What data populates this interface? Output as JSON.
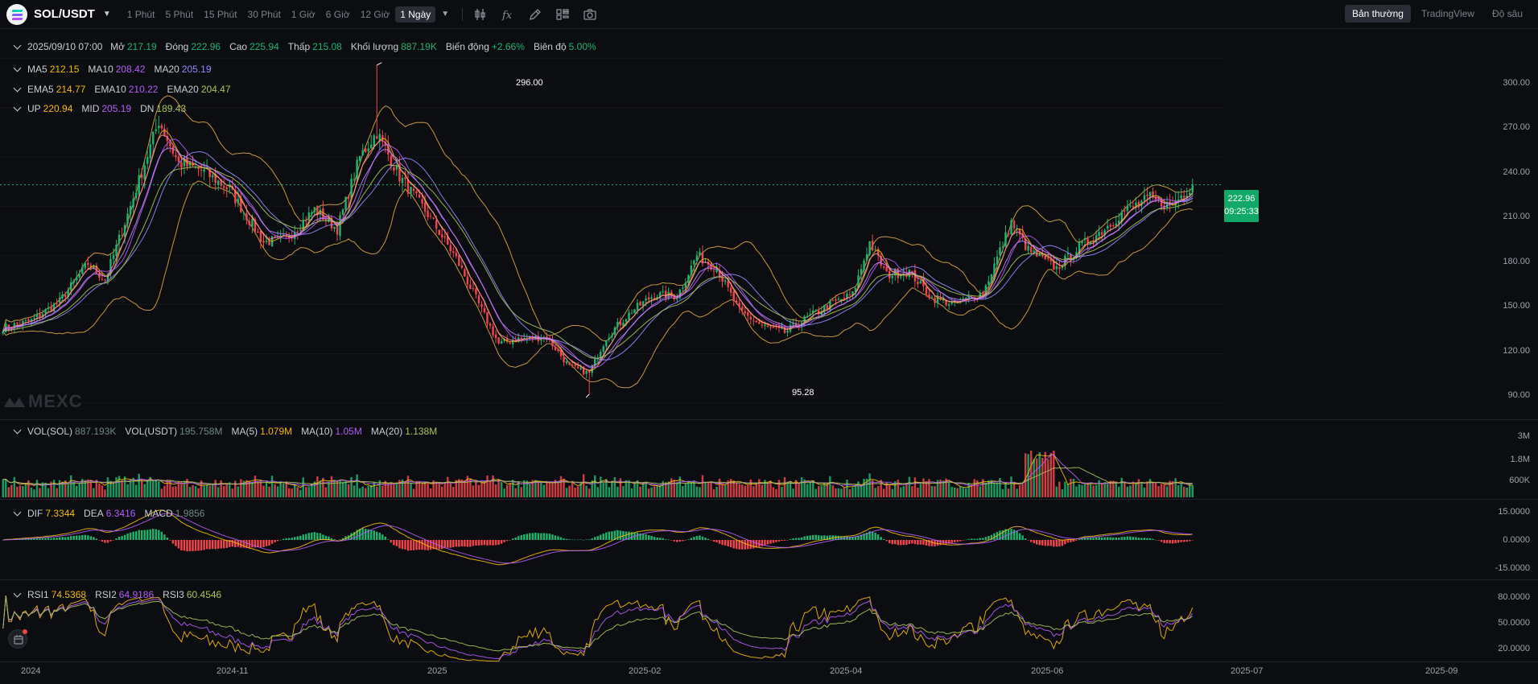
{
  "toolbar": {
    "symbol": "SOL/USDT",
    "intervals": [
      "1 Phút",
      "5 Phút",
      "15 Phút",
      "30 Phút",
      "1 Giờ",
      "6 Giờ",
      "12 Giờ",
      "1 Ngày"
    ],
    "active_interval": "1 Ngày",
    "tools": [
      "indicator-icon",
      "function-icon",
      "draw-icon",
      "layout-icon",
      "camera-icon"
    ],
    "views": [
      "Bản thường",
      "TradingView",
      "Độ sâu"
    ],
    "active_view": "Bản thường"
  },
  "ohlc": {
    "date": "2025/09/10 07:00",
    "open_label": "Mở",
    "open": "217.19",
    "close_label": "Đóng",
    "close": "222.96",
    "high_label": "Cao",
    "high": "225.94",
    "low_label": "Thấp",
    "low": "215.08",
    "volume_label": "Khối lượng",
    "volume": "887.19K",
    "change_label": "Biến động",
    "change": "+2.66%",
    "amplitude_label": "Biên độ",
    "amplitude": "5.00%"
  },
  "ma": {
    "ma5_label": "MA5",
    "ma5": "212.15",
    "ma10_label": "MA10",
    "ma10": "208.42",
    "ma20_label": "MA20",
    "ma20": "205.19"
  },
  "ema": {
    "ema5_label": "EMA5",
    "ema5": "214.77",
    "ema10_label": "EMA10",
    "ema10": "210.22",
    "ema20_label": "EMA20",
    "ema20": "204.47"
  },
  "boll": {
    "up_label": "UP",
    "up": "220.94",
    "mid_label": "MID",
    "mid": "205.19",
    "dn_label": "DN",
    "dn": "189.43"
  },
  "vol": {
    "sol_label": "VOL(SOL)",
    "sol": "887.193K",
    "usdt_label": "VOL(USDT)",
    "usdt": "195.758M",
    "ma5_label": "MA(5)",
    "ma5": "1.079M",
    "ma10_label": "MA(10)",
    "ma10": "1.05M",
    "ma20_label": "MA(20)",
    "ma20": "1.138M"
  },
  "macd": {
    "dif_label": "DIF",
    "dif": "7.3344",
    "dea_label": "DEA",
    "dea": "6.3416",
    "macd_label": "MACD",
    "macd": "1.9856"
  },
  "rsi": {
    "rsi1_label": "RSI1",
    "rsi1": "74.5368",
    "rsi2_label": "RSI2",
    "rsi2": "64.9186",
    "rsi3_label": "RSI3",
    "rsi3": "60.4546"
  },
  "price_tag": {
    "price": "222.96",
    "countdown": "09:25:33"
  },
  "watermark": "MEXC",
  "colors": {
    "up": "#20b26c",
    "down": "#ef454a",
    "ma5": "#f0b90b",
    "ma10": "#b15cf6",
    "ma20": "#8e8cff",
    "boll": "#d9a54a",
    "background": "#0c0d11"
  },
  "chart_data": {
    "type": "candlestick",
    "title": "",
    "price_axis": {
      "ticks": [
        "300.00",
        "270.00",
        "240.00",
        "210.00",
        "180.00",
        "150.00",
        "120.00",
        "90.00"
      ],
      "range": [
        80,
        318
      ]
    },
    "volume_axis": {
      "ticks": [
        "3M",
        "1.8M",
        "600K"
      ]
    },
    "macd_axis": {
      "ticks": [
        "15.0000",
        "0.0000",
        "-15.0000"
      ]
    },
    "rsi_axis": {
      "ticks": [
        "80.0000",
        "50.0000",
        "20.0000"
      ]
    },
    "x_ticks": [
      "2024",
      "2024-11",
      "2025",
      "2025-02",
      "2025-04",
      "2025-06",
      "2025-07",
      "2025-09"
    ],
    "high_marker": "296.00",
    "low_marker": "95.28",
    "close_path": [
      [
        0,
        136
      ],
      [
        10,
        140
      ],
      [
        20,
        152
      ],
      [
        30,
        175
      ],
      [
        36,
        165
      ],
      [
        45,
        210
      ],
      [
        55,
        262
      ],
      [
        62,
        236
      ],
      [
        70,
        232
      ],
      [
        80,
        220
      ],
      [
        92,
        188
      ],
      [
        100,
        190
      ],
      [
        110,
        208
      ],
      [
        118,
        196
      ],
      [
        126,
        240
      ],
      [
        132,
        255
      ],
      [
        140,
        228
      ],
      [
        150,
        205
      ],
      [
        160,
        178
      ],
      [
        168,
        150
      ],
      [
        175,
        126
      ],
      [
        182,
        129
      ],
      [
        192,
        130
      ],
      [
        200,
        112
      ],
      [
        207,
        108
      ],
      [
        213,
        130
      ],
      [
        222,
        146
      ],
      [
        230,
        156
      ],
      [
        238,
        155
      ],
      [
        245,
        180
      ],
      [
        252,
        172
      ],
      [
        260,
        146
      ],
      [
        268,
        137
      ],
      [
        276,
        133
      ],
      [
        284,
        142
      ],
      [
        292,
        150
      ],
      [
        300,
        156
      ],
      [
        306,
        188
      ],
      [
        312,
        168
      ],
      [
        320,
        170
      ],
      [
        328,
        154
      ],
      [
        336,
        150
      ],
      [
        346,
        157
      ],
      [
        356,
        200
      ],
      [
        362,
        183
      ],
      [
        372,
        172
      ],
      [
        380,
        185
      ],
      [
        388,
        195
      ],
      [
        396,
        207
      ],
      [
        405,
        215
      ],
      [
        412,
        210
      ],
      [
        420,
        222.96
      ]
    ]
  }
}
